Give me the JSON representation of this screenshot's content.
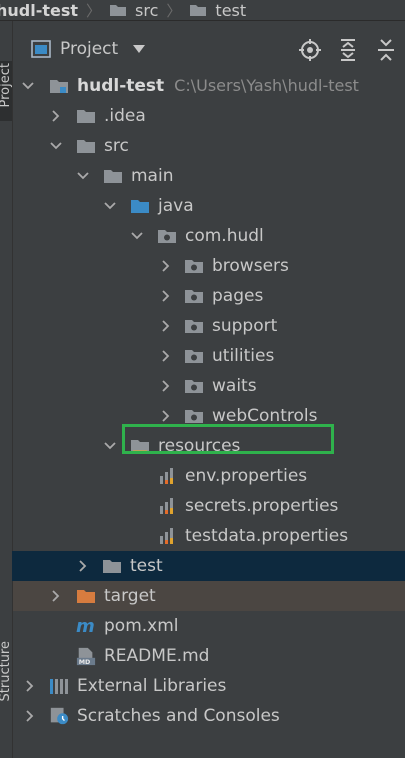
{
  "breadcrumb": {
    "project": "hudl-test",
    "items": [
      "src",
      "test"
    ]
  },
  "toolWindow": {
    "title": "Project",
    "actions": [
      "locate-icon",
      "expand-all-icon",
      "collapse-all-icon"
    ]
  },
  "sideTabs": {
    "top": "Project",
    "bottom": "Structure"
  },
  "tree": {
    "root": {
      "label": "hudl-test",
      "path": "C:\\Users\\Yash\\hudl-test"
    },
    "idea": ".idea",
    "src": "src",
    "main": "main",
    "java": "java",
    "package": "com.hudl",
    "packages": [
      "browsers",
      "pages",
      "support",
      "utilities",
      "waits",
      "webControls"
    ],
    "resources": "resources",
    "files": [
      "env.properties",
      "secrets.properties",
      "testdata.properties"
    ],
    "test": "test",
    "target": "target",
    "pom": "pom.xml",
    "readme": "README.md",
    "external": "External Libraries",
    "scratches": "Scratches and Consoles"
  },
  "colors": {
    "background": "#3c3f41",
    "selection": "#0d293e",
    "targetRow": "#4b4642",
    "folder": "#8e9398",
    "sourceFolder": "#3b8bc6",
    "excludedFolder": "#d77c3f",
    "highlight": "#2fb24c"
  }
}
